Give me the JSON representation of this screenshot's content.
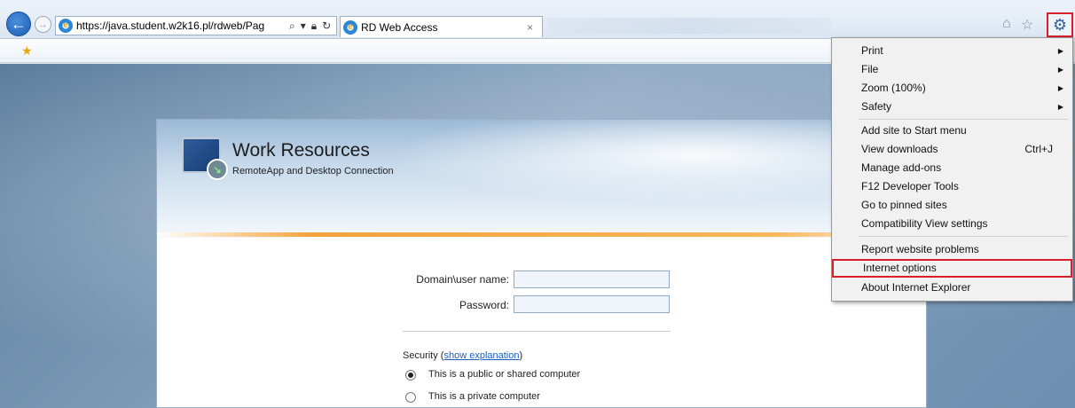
{
  "browser": {
    "url": "https://java.student.w2k16.pl/rdweb/Pag",
    "tab_title": "RD Web Access",
    "tab_close": "×",
    "back_glyph": "←",
    "forward_glyph": "→",
    "address_icons": [
      "search-icon",
      "dropdown-icon",
      "lock-icon",
      "refresh-icon"
    ],
    "toolbar_icons": [
      "home-icon",
      "favorites-star-icon",
      "tools-gear-icon"
    ]
  },
  "page": {
    "title": "Work Resources",
    "subtitle": "RemoteApp and Desktop Connection",
    "domain_label": "Domain\\user name:",
    "domain_value": "",
    "password_label": "Password:",
    "password_value": "",
    "security_label": "Security (",
    "security_link": "show explanation",
    "security_close": ")",
    "radio_public": "This is a public or shared computer",
    "radio_private": "This is a private computer",
    "selected_radio": "public"
  },
  "tools_menu": {
    "items": [
      {
        "label": "Print",
        "submenu": true
      },
      {
        "label": "File",
        "submenu": true
      },
      {
        "label": "Zoom (100%)",
        "submenu": true
      },
      {
        "label": "Safety",
        "submenu": true
      },
      {
        "label": "Add site to Start menu"
      },
      {
        "label": "View downloads",
        "shortcut": "Ctrl+J"
      },
      {
        "label": "Manage add-ons"
      },
      {
        "label": "F12 Developer Tools"
      },
      {
        "label": "Go to pinned sites"
      },
      {
        "label": "Compatibility View settings"
      },
      {
        "label": "Report website problems"
      },
      {
        "label": "Internet options",
        "highlighted": true
      },
      {
        "label": "About Internet Explorer"
      }
    ],
    "submenu_arrow": "▶"
  },
  "colors": {
    "highlight_border": "#d9202a",
    "link": "#1c5fbd",
    "accent_orange": "#f4a33a"
  }
}
